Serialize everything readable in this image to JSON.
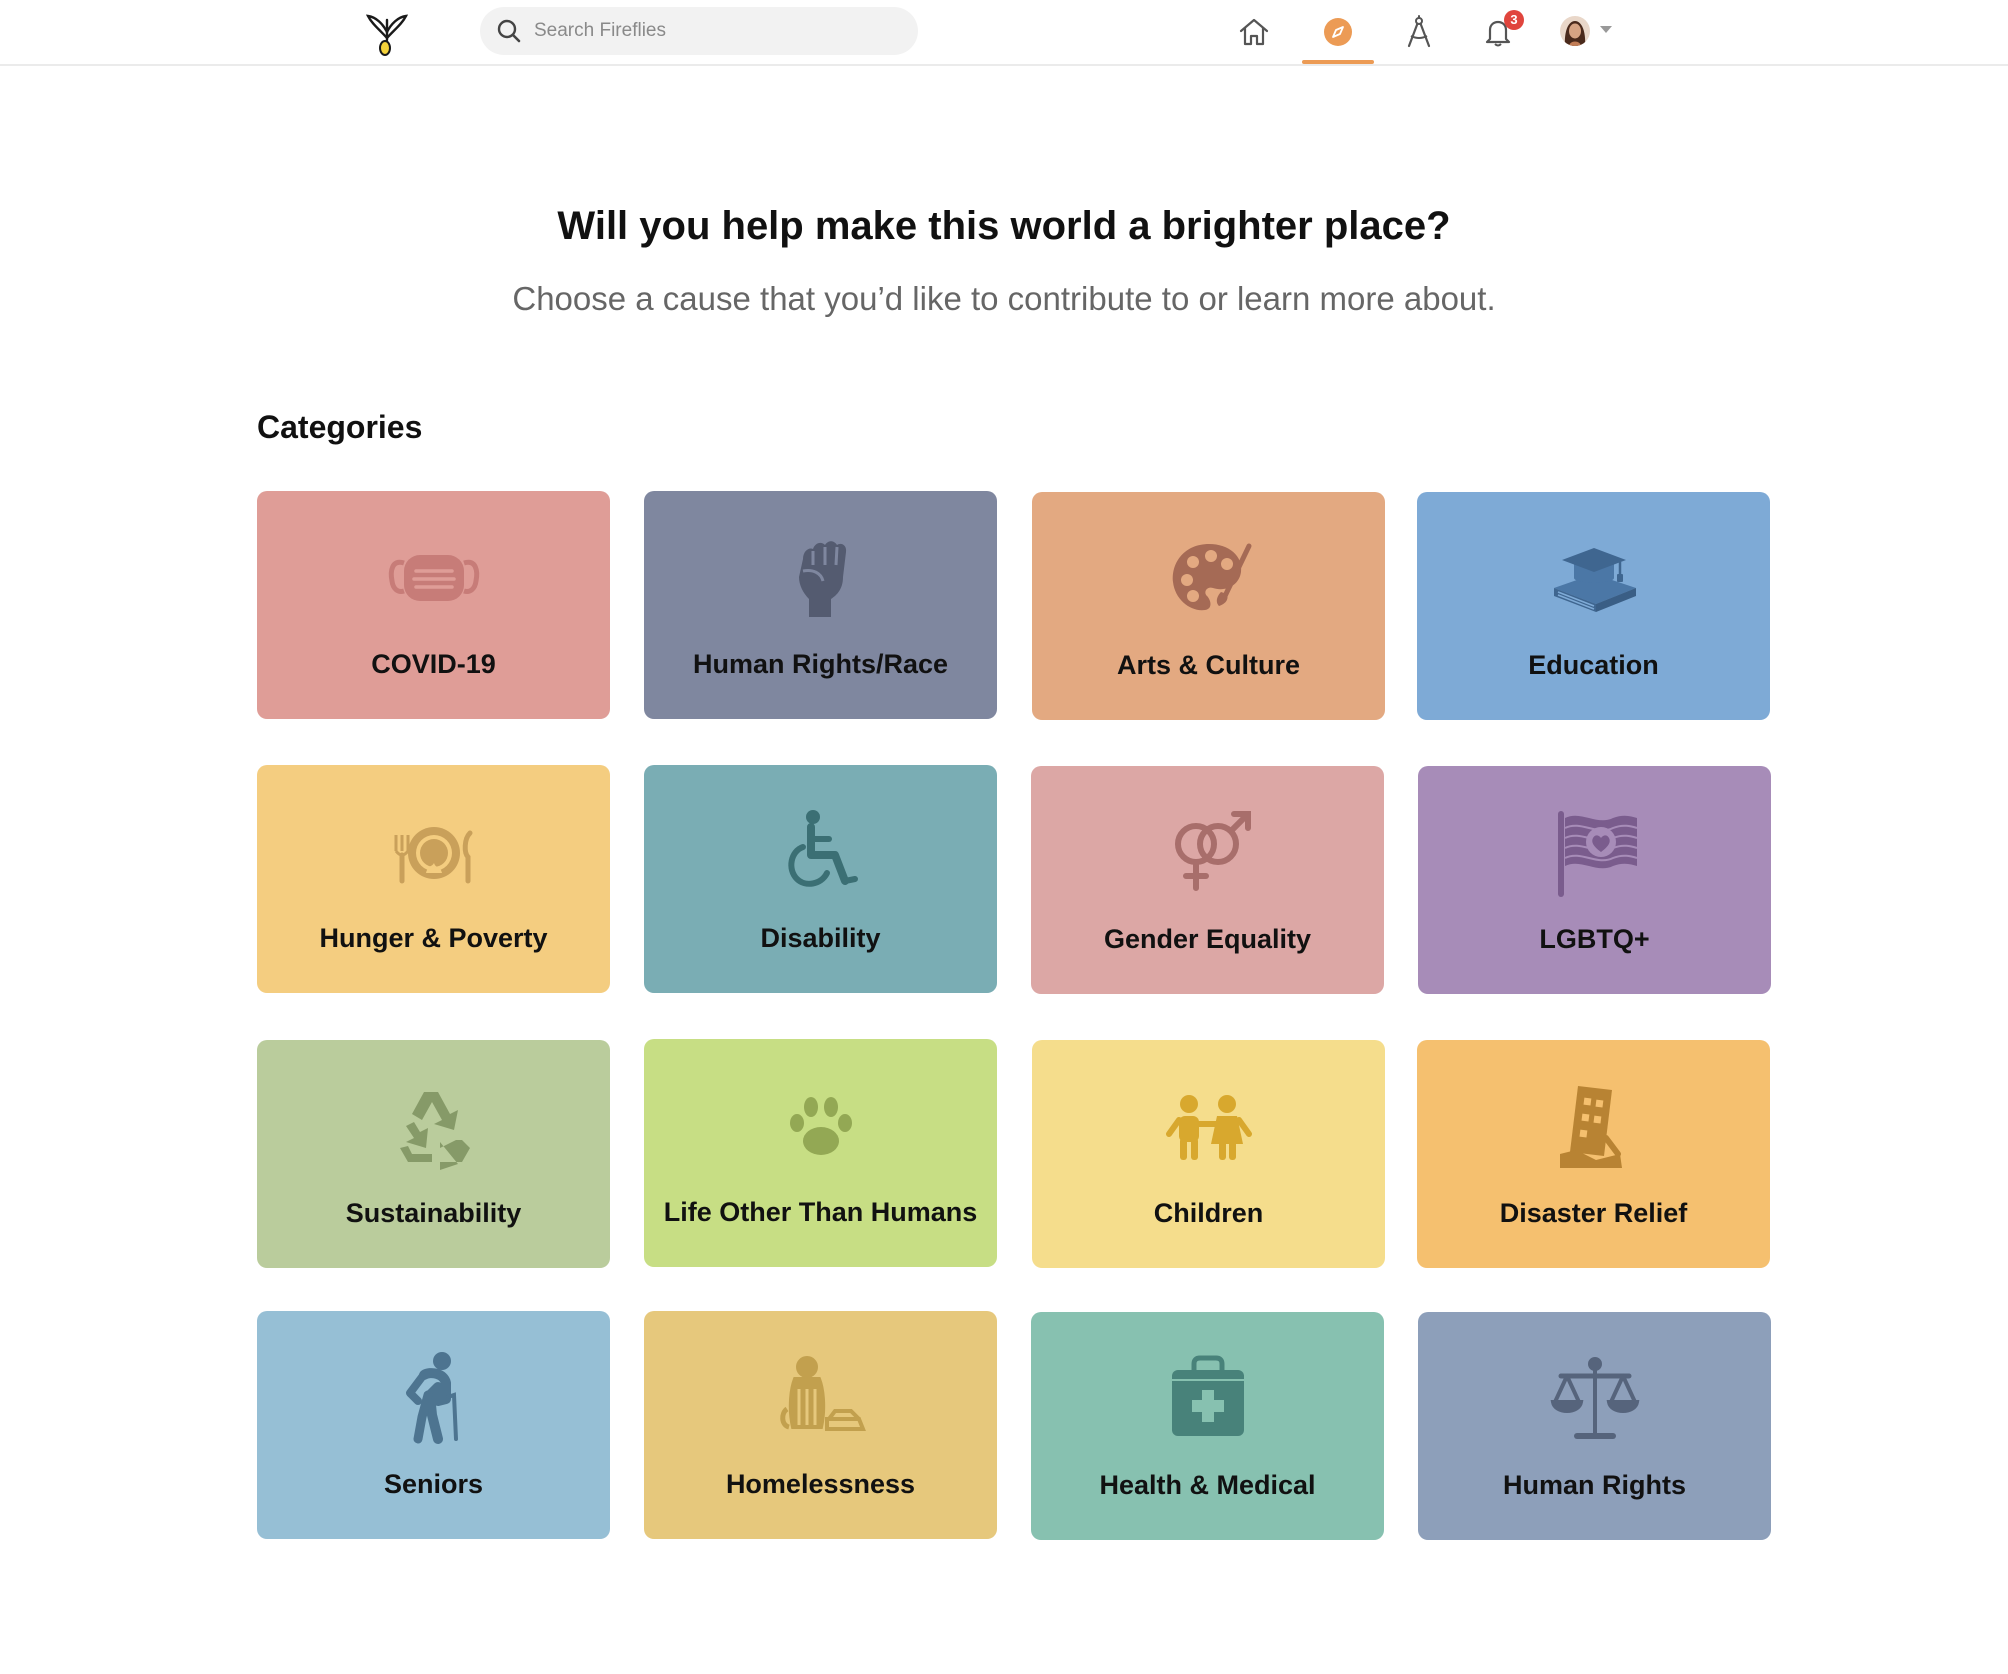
{
  "search": {
    "placeholder": "Search Fireflies"
  },
  "nav": {
    "notification_count": "3",
    "accent_color": "#ec9b55"
  },
  "hero": {
    "title": "Will you help make this world a brighter place?",
    "subtitle": "Choose a cause that you’d like to contribute to or learn more about."
  },
  "categories_heading": "Categories",
  "categories": [
    {
      "label": "COVID-19",
      "icon": "face-mask-icon",
      "color": "#df9d97"
    },
    {
      "label": "Human Rights/Race",
      "icon": "raised-fist-icon",
      "color": "#7f879f"
    },
    {
      "label": "Arts & Culture",
      "icon": "palette-icon",
      "color": "#e3a981"
    },
    {
      "label": "Education",
      "icon": "graduation-book-icon",
      "color": "#7eaad6"
    },
    {
      "label": "Hunger & Poverty",
      "icon": "plate-cutlery-icon",
      "color": "#f4cd80"
    },
    {
      "label": "Disability",
      "icon": "wheelchair-icon",
      "color": "#7aadb4"
    },
    {
      "label": "Gender Equality",
      "icon": "gender-symbols-icon",
      "color": "#dca7a5"
    },
    {
      "label": "LGBTQ+",
      "icon": "pride-flag-heart-icon",
      "color": "#a78cb8"
    },
    {
      "label": "Sustainability",
      "icon": "recycle-icon",
      "color": "#bacc9c"
    },
    {
      "label": "Life Other Than Humans",
      "icon": "paw-print-icon",
      "color": "#c7de84"
    },
    {
      "label": "Children",
      "icon": "children-icon",
      "color": "#f5dd8c"
    },
    {
      "label": "Disaster Relief",
      "icon": "collapsed-building-icon",
      "color": "#f5c06f"
    },
    {
      "label": "Seniors",
      "icon": "elderly-person-icon",
      "color": "#96bfd5"
    },
    {
      "label": "Homelessness",
      "icon": "homeless-person-icon",
      "color": "#e6c87c"
    },
    {
      "label": "Health & Medical",
      "icon": "first-aid-kit-icon",
      "color": "#87c1b0"
    },
    {
      "label": "Human Rights",
      "icon": "scales-icon",
      "color": "#8d9fba"
    }
  ]
}
